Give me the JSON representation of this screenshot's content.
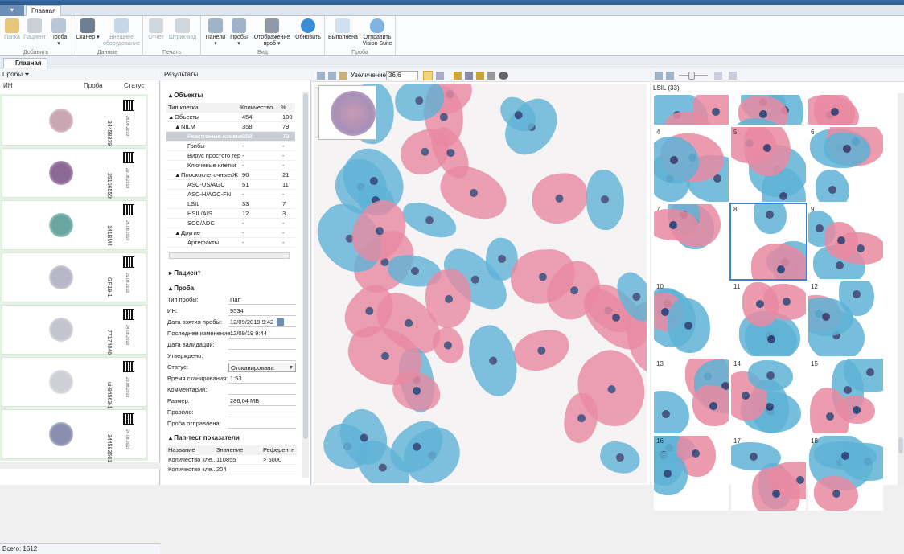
{
  "ribbon": {
    "tab": "Главная",
    "groups": [
      {
        "label": "Добавить",
        "buttons": [
          "Папка",
          "Пациент",
          "Проба"
        ]
      },
      {
        "label": "Данные",
        "buttons": [
          "Сканер",
          "Внешнее оборудование"
        ]
      },
      {
        "label": "Печать",
        "buttons": [
          "Отчет",
          "Штрих-код"
        ]
      },
      {
        "label": "Вид",
        "buttons": [
          "Панели",
          "Пробы",
          "Отображение проб",
          "Обновить"
        ]
      },
      {
        "label": "Проба",
        "buttons": [
          "Выполнена",
          "Отправить Vision Suite"
        ]
      }
    ]
  },
  "doc_tab": "Главная",
  "samples_panel": {
    "title": "Пробы",
    "columns": [
      "ИН",
      "Проба",
      "Статус"
    ],
    "items": [
      {
        "id": "3445837940",
        "date": "26.08.2019",
        "stain": "#c9a6b2"
      },
      {
        "id": "2510655080634",
        "date": "29.08.2019",
        "stain": "#8c6a95"
      },
      {
        "id": "141BM4",
        "date": "26.08.2019",
        "stain": "#6aa6a0"
      },
      {
        "id": "GR19-1",
        "date": "29.08.2019",
        "stain": "#b7b7c8"
      },
      {
        "id": "7717404604",
        "date": "24.08.2019",
        "stain": "#c4c4cf"
      },
      {
        "id": "ui-94563-1",
        "date": "29.08.2019",
        "stain": "#cfcfd8"
      },
      {
        "id": "3445835616",
        "date": "24.08.2019",
        "stain": "#8a8fb0"
      }
    ],
    "total": "Всего: 1612"
  },
  "results_panel": {
    "title": "Результаты",
    "objects_header": "Объекты",
    "table_headers": [
      "Тип клетки",
      "Количество",
      "%"
    ],
    "rows": [
      {
        "name": "Объекты",
        "count": "454",
        "pct": "100",
        "indent": 0,
        "toggle": "▲"
      },
      {
        "name": "NILM",
        "count": "358",
        "pct": "79",
        "indent": 1,
        "toggle": "▲"
      },
      {
        "name": "Реактивные измене",
        "count": "358",
        "pct": "79",
        "indent": 2,
        "toggle": "",
        "selected": true
      },
      {
        "name": "Грибы",
        "count": "-",
        "pct": "-",
        "indent": 2,
        "toggle": ""
      },
      {
        "name": "Вирус простого гер",
        "count": "-",
        "pct": "-",
        "indent": 2,
        "toggle": ""
      },
      {
        "name": "Ключевые клетки",
        "count": "-",
        "pct": "-",
        "indent": 2,
        "toggle": ""
      },
      {
        "name": "Плоскоклеточные/Ж",
        "count": "96",
        "pct": "21",
        "indent": 1,
        "toggle": "▲"
      },
      {
        "name": "ASC-US/AGC",
        "count": "51",
        "pct": "11",
        "indent": 2,
        "toggle": ""
      },
      {
        "name": "ASC-H/AGC-FN",
        "count": "-",
        "pct": "-",
        "indent": 2,
        "toggle": ""
      },
      {
        "name": "LSIL",
        "count": "33",
        "pct": "7",
        "indent": 2,
        "toggle": ""
      },
      {
        "name": "HSIL/AIS",
        "count": "12",
        "pct": "3",
        "indent": 2,
        "toggle": ""
      },
      {
        "name": "SCC/ADC",
        "count": "-",
        "pct": "-",
        "indent": 2,
        "toggle": ""
      },
      {
        "name": "Другие",
        "count": "-",
        "pct": "-",
        "indent": 1,
        "toggle": "▲"
      },
      {
        "name": "Артефакты",
        "count": "-",
        "pct": "-",
        "indent": 2,
        "toggle": ""
      }
    ],
    "patient_header": "Пациент",
    "sample_header": "Проба",
    "fields": [
      {
        "label": "Тип пробы:",
        "value": "Пап"
      },
      {
        "label": "ИН:",
        "value": "9534"
      },
      {
        "label": "Дата взятия пробы:",
        "value": "12/09/2019 9:42"
      },
      {
        "label": "Последнее изменение:",
        "value": "12/09/19 9:44"
      },
      {
        "label": "Дата валидации:",
        "value": ""
      },
      {
        "label": "Утверждено:",
        "value": ""
      },
      {
        "label": "Статус:",
        "value": "Отсканирована"
      },
      {
        "label": "Время сканирования:",
        "value": "1:53"
      },
      {
        "label": "Комментарий:",
        "value": ""
      },
      {
        "label": "Размер:",
        "value": "286,04 МБ"
      },
      {
        "label": "Правило:",
        "value": ""
      },
      {
        "label": "Проба отправлена:",
        "value": ""
      }
    ],
    "pap_header": "Пап-тест показатели",
    "pap_columns": [
      "Название",
      "Значение",
      "Референтн"
    ],
    "pap_rows": [
      {
        "name": "Количество кле...",
        "value": "110855",
        "ref": "> 5000"
      },
      {
        "name": "Количество кле...",
        "value": "204",
        "ref": ""
      }
    ]
  },
  "viewer": {
    "zoom_label": "Увеличение",
    "zoom_value": "36,6"
  },
  "gallery": {
    "title": "LSIL (33)",
    "tiles": [
      "",
      "",
      "",
      "4",
      "5",
      "6",
      "7",
      "8",
      "9",
      "10",
      "11",
      "12",
      "13",
      "14",
      "15",
      "16",
      "17",
      "18"
    ]
  },
  "colors": {
    "nucleus": "#2b3a6e",
    "blue_cell": "#5fb3d6",
    "pink_cell": "#e98aa2",
    "selection": "#3c7fd6"
  }
}
